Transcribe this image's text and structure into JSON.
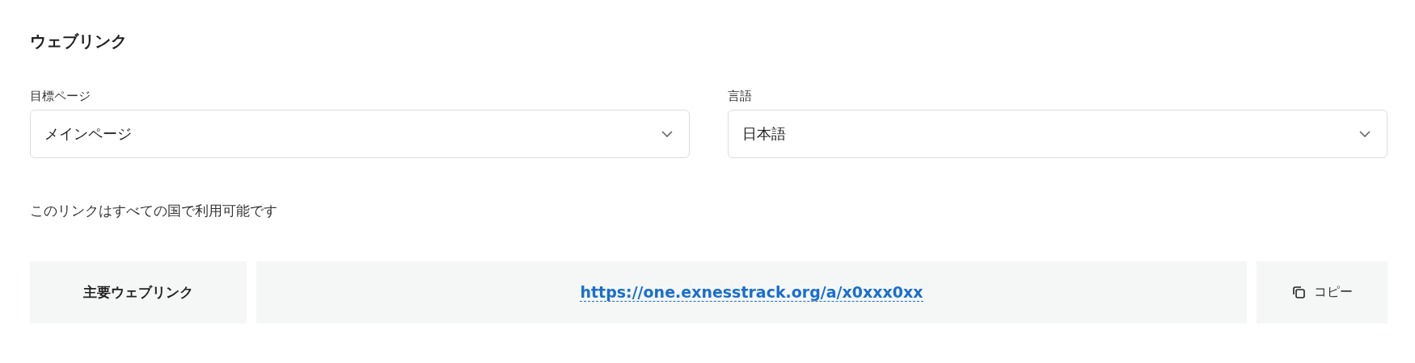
{
  "section_title": "ウェブリンク",
  "selects": [
    {
      "label": "目標ページ",
      "value": "メインページ"
    },
    {
      "label": "言語",
      "value": "日本語"
    }
  ],
  "availability_note": "このリンクはすべての国で利用可能です",
  "link_row": {
    "label": "主要ウェブリンク",
    "url": "https://one.exnesstrack.org/a/x0xxx0xx",
    "copy_button": "コピー"
  }
}
